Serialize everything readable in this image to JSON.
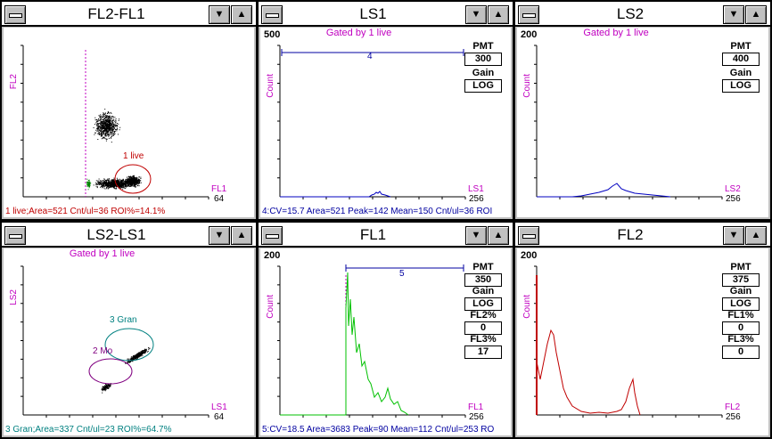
{
  "windows": [
    {
      "id": "fl2fl1",
      "title": "FL2-FL1",
      "gated": "",
      "ymax": "",
      "xmax": "64",
      "xlabel": "FL1",
      "ylabel": "FL2",
      "status": "1 live;Area=521 Cnt/ul=36 ROI%=14.1%",
      "status_color": "#c00000",
      "region_label": "1 live",
      "controls": []
    },
    {
      "id": "ls1",
      "title": "LS1",
      "gated": "Gated by 1 live",
      "ymax": "500",
      "xmax": "256",
      "xlabel": "LS1",
      "ylabel": "Count",
      "status": "4:CV=15.7 Area=521 Peak=142 Mean=150 Cnt/ul=36 ROI",
      "status_color": "#0000a0",
      "marker": "4",
      "controls": [
        {
          "label": "PMT",
          "value": "300"
        },
        {
          "label": "Gain",
          "value": "LOG"
        }
      ]
    },
    {
      "id": "ls2",
      "title": "LS2",
      "gated": "Gated by 1 live",
      "ymax": "200",
      "xmax": "256",
      "xlabel": "LS2",
      "ylabel": "Count",
      "status": "",
      "controls": [
        {
          "label": "PMT",
          "value": "400"
        },
        {
          "label": "Gain",
          "value": "LOG"
        }
      ]
    },
    {
      "id": "ls2ls1",
      "title": "LS2-LS1",
      "gated": "Gated by 1 live",
      "ymax": "",
      "xmax": "64",
      "xlabel": "LS1",
      "ylabel": "LS2",
      "status": "3 Gran;Area=337 Cnt/ul=23 ROI%=64.7%",
      "status_color": "#008080",
      "region_label": "3 Gran",
      "region2_label": "2 Mo",
      "controls": []
    },
    {
      "id": "fl1",
      "title": "FL1",
      "gated": "",
      "ymax": "200",
      "xmax": "256",
      "xlabel": "FL1",
      "ylabel": "Count",
      "status": "5:CV=18.5 Area=3683 Peak=90 Mean=112 Cnt/ul=253 RO",
      "status_color": "#0000a0",
      "marker": "5",
      "controls": [
        {
          "label": "PMT",
          "value": "350"
        },
        {
          "label": "Gain",
          "value": "LOG"
        },
        {
          "label": "FL2%",
          "value": "0"
        },
        {
          "label": "FL3%",
          "value": "17"
        }
      ]
    },
    {
      "id": "fl2",
      "title": "FL2",
      "gated": "",
      "ymax": "200",
      "xmax": "256",
      "xlabel": "FL2",
      "ylabel": "Count",
      "status": "",
      "controls": [
        {
          "label": "PMT",
          "value": "375"
        },
        {
          "label": "Gain",
          "value": "LOG"
        },
        {
          "label": "FL1%",
          "value": "0"
        },
        {
          "label": "FL3%",
          "value": "0"
        }
      ]
    }
  ],
  "icons": {
    "system_menu": "minus-bar-icon",
    "minimize": "down-triangle-icon",
    "maximize": "up-triangle-icon"
  }
}
